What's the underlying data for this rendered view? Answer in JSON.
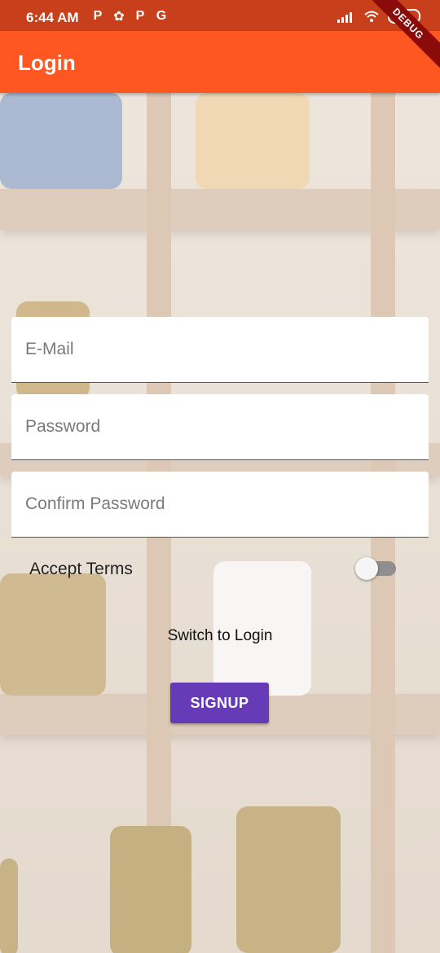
{
  "status_bar": {
    "time": "6:44 AM",
    "left_icons": [
      "P",
      "✿",
      "P",
      "G"
    ],
    "battery": "28",
    "debug_label": "DEBUG"
  },
  "app_bar": {
    "title": "Login"
  },
  "form": {
    "email": {
      "placeholder": "E-Mail",
      "value": ""
    },
    "password": {
      "placeholder": "Password",
      "value": ""
    },
    "confirm_password": {
      "placeholder": "Confirm Password",
      "value": ""
    },
    "accept_terms": {
      "label": "Accept Terms",
      "checked": false
    },
    "switch_mode_label": "Switch to Login",
    "submit_label": "SIGNUP"
  },
  "colors": {
    "app_bar": "#ff5722",
    "status_bar": "#c8401b",
    "button": "#673ab7"
  }
}
